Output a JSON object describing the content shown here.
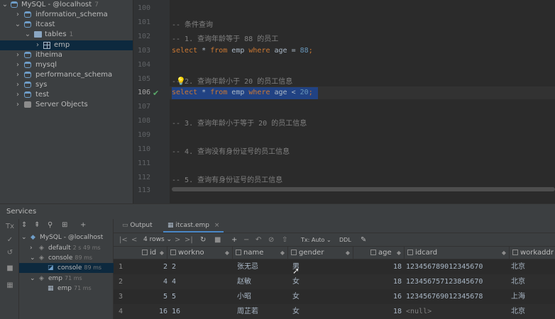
{
  "tree": {
    "items": [
      {
        "label": "MySQL - @localhost",
        "meta": "7",
        "kind": "server",
        "expanded": true
      },
      {
        "label": "information_schema",
        "kind": "db",
        "expanded": false
      },
      {
        "label": "itcast",
        "kind": "db",
        "expanded": true
      },
      {
        "label": "tables",
        "meta": "1",
        "kind": "folder",
        "expanded": true
      },
      {
        "label": "emp",
        "kind": "table",
        "expanded": false,
        "selected": true
      },
      {
        "label": "itheima",
        "kind": "db",
        "expanded": false
      },
      {
        "label": "mysql",
        "kind": "db",
        "expanded": false
      },
      {
        "label": "performance_schema",
        "kind": "db",
        "expanded": false
      },
      {
        "label": "sys",
        "kind": "db",
        "expanded": false
      },
      {
        "label": "test",
        "kind": "db",
        "expanded": false
      },
      {
        "label": "Server Objects",
        "kind": "server-objects",
        "expanded": false
      }
    ]
  },
  "editor": {
    "lines": [
      {
        "num": "100",
        "text": ""
      },
      {
        "num": "101",
        "text": "-- 条件查询",
        "type": "comment"
      },
      {
        "num": "102",
        "text": "-- 1. 查询年龄等于 88 的员工",
        "type": "comment"
      },
      {
        "num": "103",
        "text": "select * from emp where age = 88;",
        "type": "sql"
      },
      {
        "num": "104",
        "text": ""
      },
      {
        "num": "105",
        "text": "-- 2. 查询年龄小于 20 的员工信息",
        "type": "comment"
      },
      {
        "num": "106",
        "text": "select * from emp where age < 20;",
        "type": "sql",
        "current": true
      },
      {
        "num": "107",
        "text": ""
      },
      {
        "num": "108",
        "text": "-- 3. 查询年龄小于等于 20 的员工信息",
        "type": "comment"
      },
      {
        "num": "109",
        "text": ""
      },
      {
        "num": "110",
        "text": "-- 4. 查询没有身份证号的员工信息",
        "type": "comment"
      },
      {
        "num": "111",
        "text": ""
      },
      {
        "num": "112",
        "text": "-- 5. 查询有身份证号的员工信息",
        "type": "comment"
      },
      {
        "num": "113",
        "text": ""
      }
    ]
  },
  "services": {
    "title": "Services",
    "tree": [
      {
        "label": "MySQL - @localhost",
        "meta": ""
      },
      {
        "label": "default",
        "meta": "2 s 49 ms"
      },
      {
        "label": "console",
        "meta": "89 ms"
      },
      {
        "label": "console",
        "meta": "89 ms",
        "selected": true
      },
      {
        "label": "emp",
        "meta": "71 ms"
      },
      {
        "label": "emp",
        "meta": "71 ms"
      }
    ]
  },
  "results": {
    "tabs": [
      {
        "label": "Output",
        "active": false
      },
      {
        "label": "itcast.emp",
        "active": true
      }
    ],
    "rows_label": "4 rows",
    "tx_label": "Tx: Auto",
    "ddl_label": "DDL",
    "columns": [
      "id",
      "workno",
      "name",
      "gender",
      "age",
      "idcard",
      "workaddr"
    ],
    "rows": [
      {
        "n": "1",
        "id": "2",
        "workno": "2",
        "name": "张无忌",
        "gender": "男",
        "age": "18",
        "idcard": "123456789012345670",
        "workaddr": "北京"
      },
      {
        "n": "2",
        "id": "4",
        "workno": "4",
        "name": "赵敏",
        "gender": "女",
        "age": "18",
        "idcard": "123456757123845670",
        "workaddr": "北京"
      },
      {
        "n": "3",
        "id": "5",
        "workno": "5",
        "name": "小昭",
        "gender": "女",
        "age": "16",
        "idcard": "123456769012345678",
        "workaddr": "上海"
      },
      {
        "n": "4",
        "id": "16",
        "workno": "16",
        "name": "周芷若",
        "gender": "女",
        "age": "18",
        "idcard": "<null>",
        "workaddr": "北京"
      }
    ]
  },
  "colors": {
    "keyword": "#cc7832",
    "number": "#6897bb",
    "comment": "#808080",
    "selection": "#214283"
  }
}
